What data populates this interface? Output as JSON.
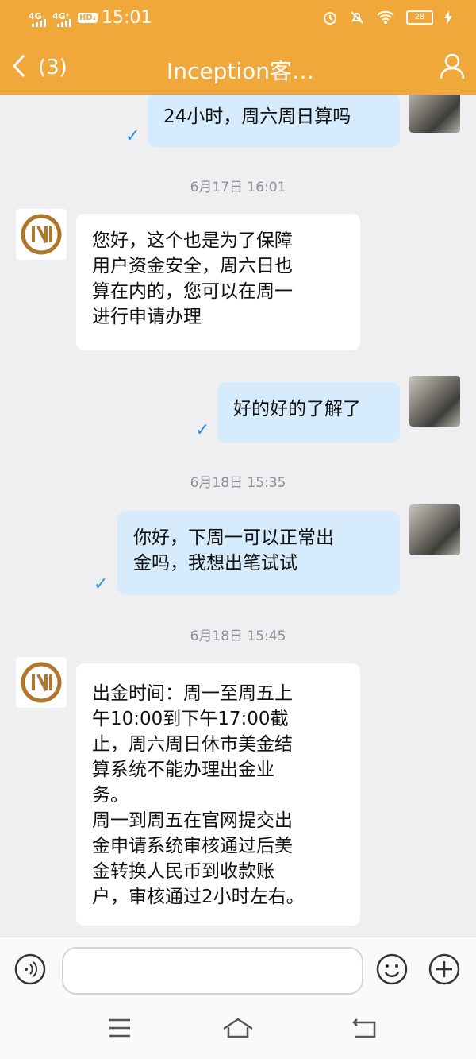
{
  "status_bar": {
    "net1": "4G",
    "net2": "4G⁺",
    "hd": "HD₂",
    "time": "15:01",
    "battery": "28"
  },
  "header": {
    "unread_count": "(3)",
    "title": "Inception客…",
    "accent_color": "#f1a83a"
  },
  "messages": [
    {
      "side": "me",
      "text": "24小时，周六周日算吗"
    },
    {
      "side": "timestamp",
      "text": "6月17日 16:01"
    },
    {
      "side": "bot",
      "lines": [
        "您好，这个也是为了保障",
        "用户资金安全，周六日也",
        "算在内的，您可以在周一",
        "进行申请办理"
      ]
    },
    {
      "side": "me",
      "text": "好的好的了解了"
    },
    {
      "side": "timestamp",
      "text": "6月18日 15:35"
    },
    {
      "side": "me",
      "lines": [
        "你好，下周一可以正常出",
        "金吗，我想出笔试试"
      ]
    },
    {
      "side": "timestamp",
      "text": "6月18日 15:45"
    },
    {
      "side": "bot",
      "lines": [
        "出金时间：周一至周五上",
        "午10:00到下午17:00截",
        "止，周六周日休市美金结",
        "算系统不能办理出金业",
        "务。",
        "周一到周五在官网提交出",
        "金申请系统审核通过后美",
        "金转换人民币到收款账",
        "户，审核通过2小时左右。"
      ]
    }
  ],
  "input": {
    "placeholder": ""
  },
  "icons": [
    "voice-icon",
    "emoji-icon",
    "plus-icon",
    "menu-icon",
    "home-icon",
    "back-nav-icon"
  ]
}
